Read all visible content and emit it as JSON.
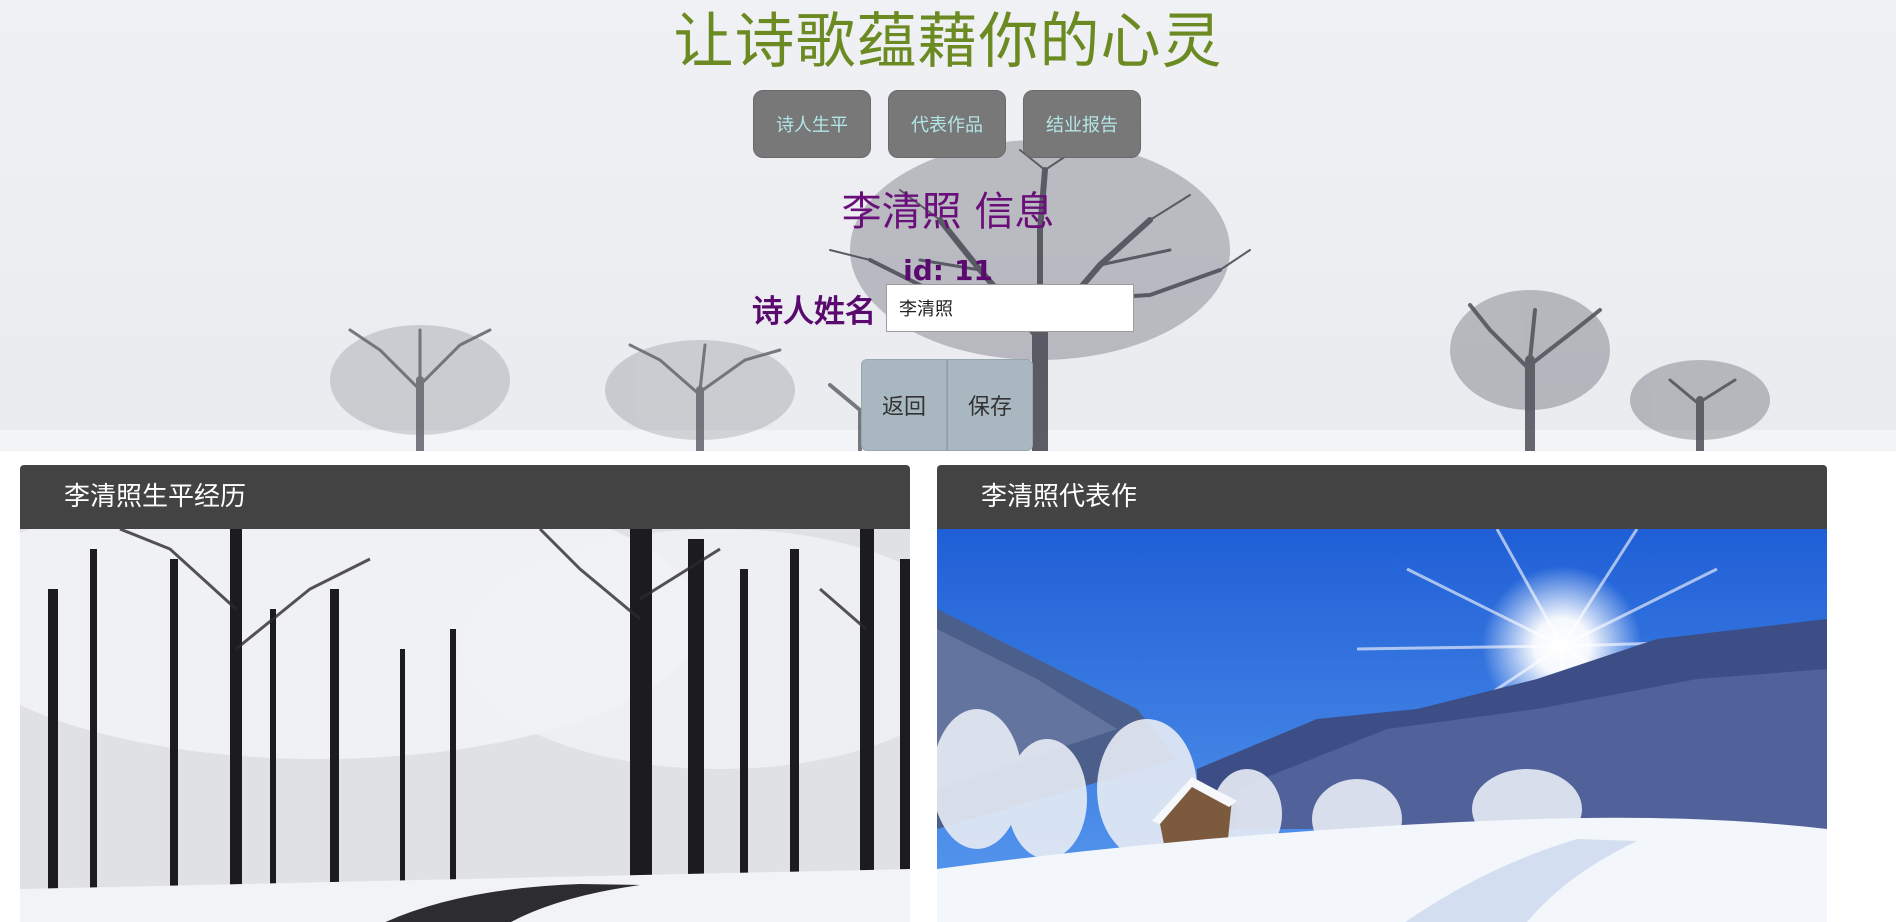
{
  "header": {
    "title": "让诗歌蕴藉你的心灵"
  },
  "nav": {
    "items": [
      {
        "label": "诗人生平"
      },
      {
        "label": "代表作品"
      },
      {
        "label": "结业报告"
      }
    ]
  },
  "poet_info": {
    "heading": "李清照 信息",
    "id_label": "id:",
    "id_value": "11",
    "name_label": "诗人姓名",
    "name_value": "李清照"
  },
  "actions": {
    "back_label": "返回",
    "save_label": "保存"
  },
  "cards": [
    {
      "title": "李清照生平经历",
      "image": "snowy-forest-road-photo"
    },
    {
      "title": "李清照代表作",
      "image": "snowy-mountain-sunburst-photo"
    }
  ],
  "colors": {
    "title": "#6b8a22",
    "nav_bg": "#787878",
    "nav_text": "#b3e6e6",
    "info_text": "#6a0f7a",
    "card_header_bg": "#434343",
    "action_bg": "#a9b8c0"
  }
}
